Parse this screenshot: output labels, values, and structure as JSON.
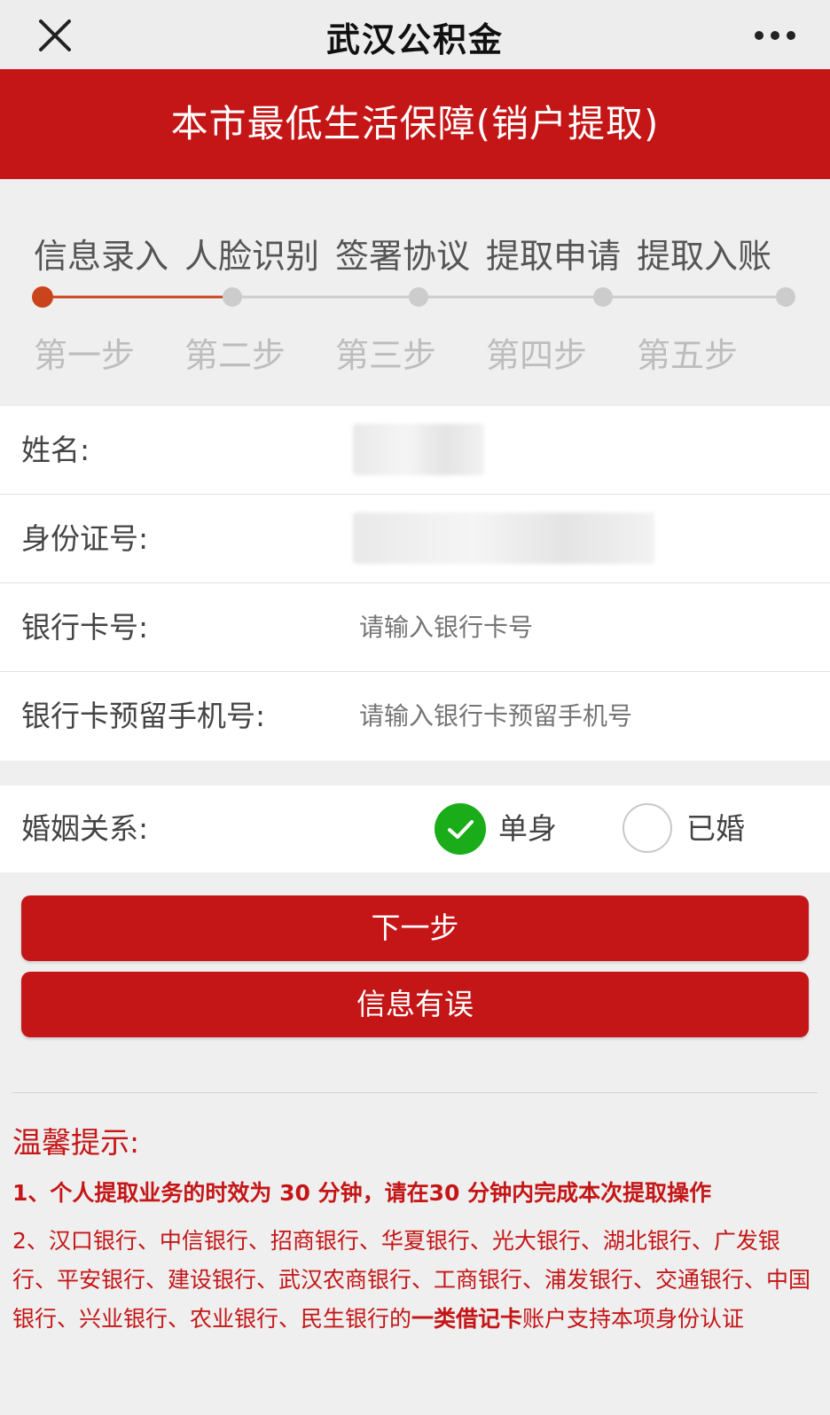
{
  "navbar": {
    "title": "武汉公积金",
    "close_icon": "close-icon",
    "more_icon": "more-icon"
  },
  "banner": {
    "title": "本市最低生活保障(销户提取)"
  },
  "steps": {
    "items": [
      {
        "name": "信息录入",
        "number": "第一步"
      },
      {
        "name": "人脸识别",
        "number": "第二步"
      },
      {
        "name": "签署协议",
        "number": "第三步"
      },
      {
        "name": "提取申请",
        "number": "第四步"
      },
      {
        "name": "提取入账",
        "number": "第五步"
      }
    ],
    "current_step": 1,
    "active_color": "#c9431b",
    "inactive_color": "#cccccc"
  },
  "form": {
    "name": {
      "label": "姓名:"
    },
    "id_number": {
      "label": "身份证号:"
    },
    "bank_card": {
      "label": "银行卡号:",
      "placeholder": "请输入银行卡号",
      "value": ""
    },
    "phone": {
      "label": "银行卡预留手机号:",
      "placeholder": "请输入银行卡预留手机号",
      "value": ""
    }
  },
  "marital": {
    "label": "婚姻关系:",
    "options": [
      {
        "label": "单身",
        "selected": true
      },
      {
        "label": "已婚",
        "selected": false
      }
    ],
    "check_icon": "check-icon"
  },
  "buttons": {
    "next": "下一步",
    "error": "信息有误"
  },
  "tips": {
    "title": "温馨提示:",
    "item1": "1、个人提取业务的时效为 30 分钟，请在30 分钟内完成本次提取操作",
    "item2_prefix": "2、汉口银行、中信银行、招商银行、华夏银行、光大银行、湖北银行、广发银行、平安银行、建设银行、武汉农商银行、工商银行、浦发银行、交通银行、中国银行、兴业银行、农业银行、民生银行的",
    "item2_bold": "一类借记卡",
    "item2_suffix": "账户支持本项身份认证"
  },
  "colors": {
    "brand_red": "#c51617",
    "radio_green": "#1aad19"
  }
}
